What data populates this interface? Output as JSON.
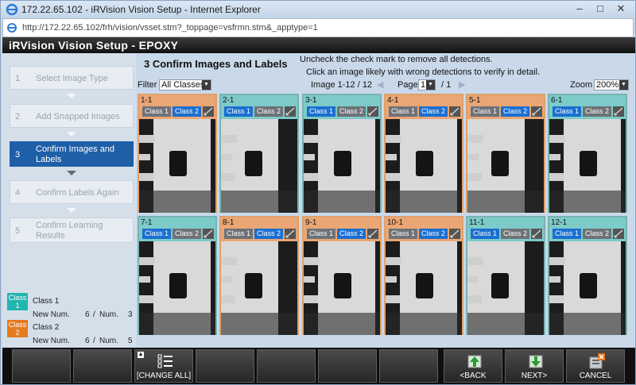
{
  "window": {
    "title": "172.22.65.102 - iRVision Vision Setup - Internet Explorer",
    "url": "http://172.22.65.102/frh/vision/vsset.stm?_toppage=vsfrmn.stm&_apptype=1"
  },
  "app": {
    "title": "iRVision Vision Setup - EPOXY"
  },
  "steps": [
    {
      "num": "1",
      "label": "Select Image Type",
      "active": false
    },
    {
      "num": "2",
      "label": "Add Snapped Images",
      "active": false
    },
    {
      "num": "3",
      "label": "Confirm Images and Labels",
      "active": true
    },
    {
      "num": "4",
      "label": "Confirm Labels Again",
      "active": false
    },
    {
      "num": "5",
      "label": "Confirm Learning Results",
      "active": false
    }
  ],
  "classes": [
    {
      "badge": "Class 1",
      "name": "Class 1",
      "new_num_label": "New Num.",
      "new_num": "6",
      "num_label": "Num.",
      "num": "3",
      "color": "#22b5b0"
    },
    {
      "badge": "Class 2",
      "name": "Class 2",
      "new_num_label": "New Num.",
      "new_num": "6",
      "num_label": "Num.",
      "num": "5",
      "color": "#e67a1e"
    }
  ],
  "main": {
    "heading": "3 Confirm Images and Labels",
    "instruction1": "Uncheck the check mark to remove all detections.",
    "instruction2": "Click an image likely with wrong detections to verify in detail.",
    "filter_label": "Filter",
    "filter_value": "All Classes",
    "image_range": "Image 1-12 / 12",
    "page_label": "Page",
    "page_value": "1",
    "page_total": "/ 1",
    "zoom_label": "Zoom",
    "zoom_value": "200%"
  },
  "tiles": [
    {
      "id": "1-1",
      "header": "orange",
      "class1_on": false,
      "class2_on": true
    },
    {
      "id": "2-1",
      "header": "teal",
      "class1_on": true,
      "class2_on": false
    },
    {
      "id": "3-1",
      "header": "teal",
      "class1_on": true,
      "class2_on": false
    },
    {
      "id": "4-1",
      "header": "orange",
      "class1_on": false,
      "class2_on": true
    },
    {
      "id": "5-1",
      "header": "orange",
      "class1_on": false,
      "class2_on": true
    },
    {
      "id": "6-1",
      "header": "teal",
      "class1_on": true,
      "class2_on": false
    },
    {
      "id": "7-1",
      "header": "teal",
      "class1_on": true,
      "class2_on": false
    },
    {
      "id": "8-1",
      "header": "orange",
      "class1_on": false,
      "class2_on": true
    },
    {
      "id": "9-1",
      "header": "orange",
      "class1_on": false,
      "class2_on": true
    },
    {
      "id": "10-1",
      "header": "orange",
      "class1_on": false,
      "class2_on": true
    },
    {
      "id": "11-1",
      "header": "teal",
      "class1_on": true,
      "class2_on": false
    },
    {
      "id": "12-1",
      "header": "teal",
      "class1_on": true,
      "class2_on": false
    }
  ],
  "chip_labels": {
    "class1": "Class 1",
    "class2": "Class 2"
  },
  "toolbar": {
    "change_all": "[CHANGE ALL]",
    "back": "<BACK",
    "next": "NEXT>",
    "cancel": "CANCEL"
  }
}
